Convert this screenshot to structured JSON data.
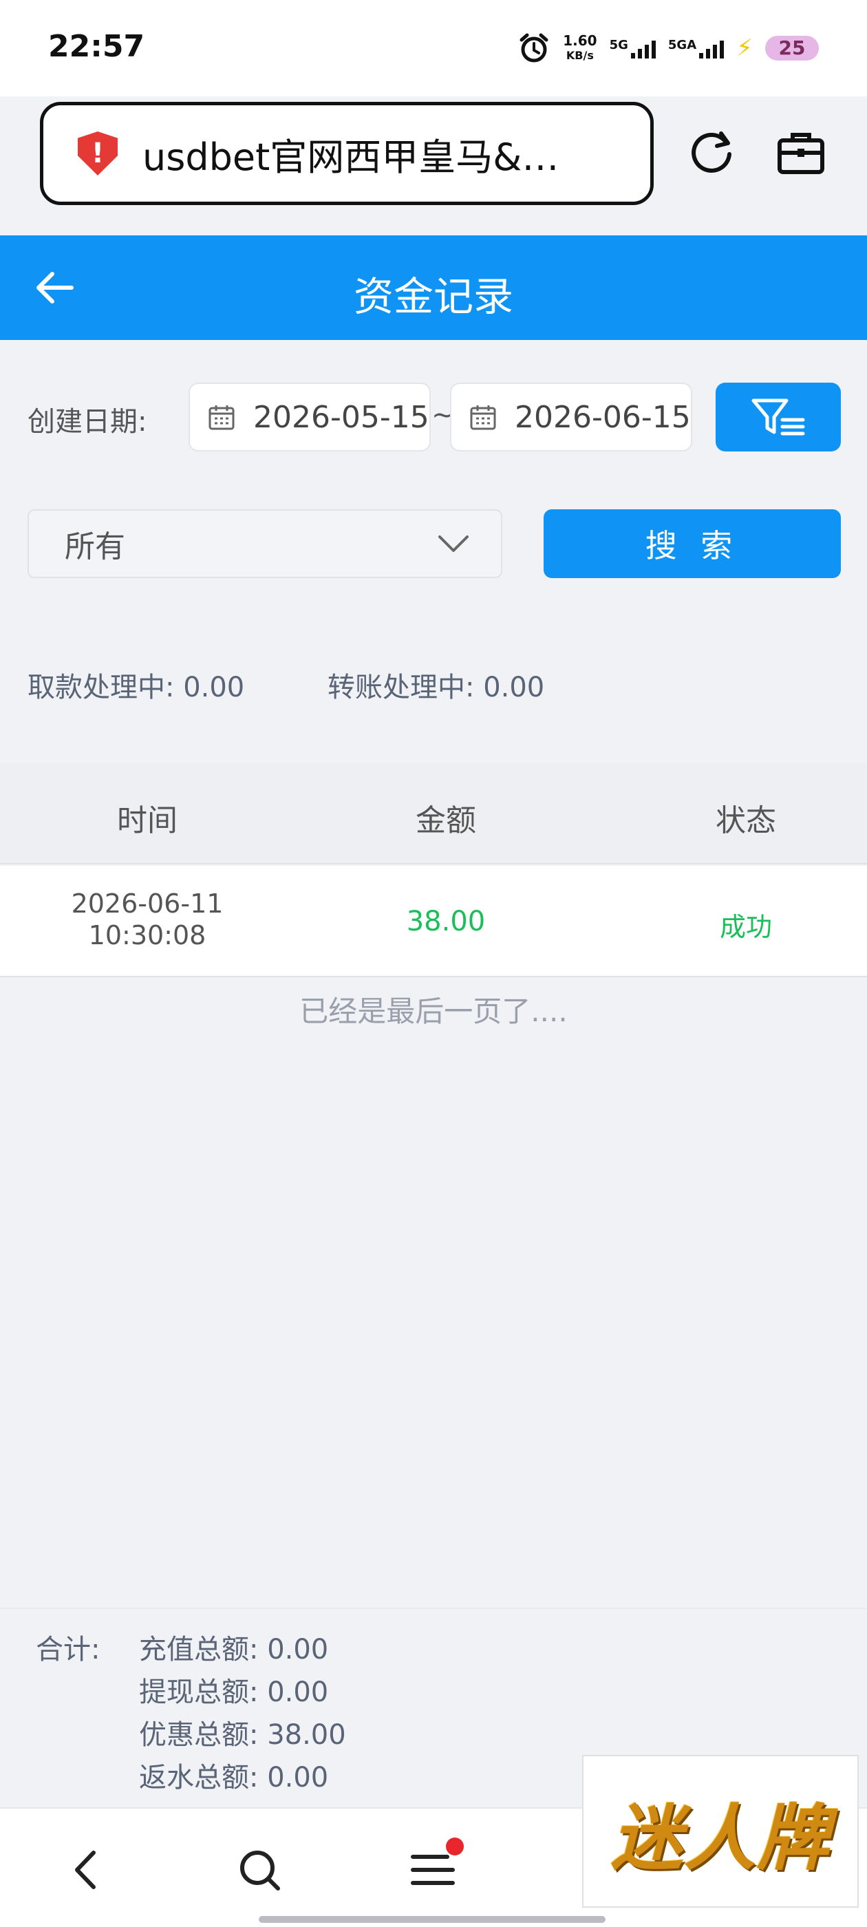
{
  "status_bar": {
    "time": "22:57",
    "speed_value": "1.60",
    "speed_unit": "KB/s",
    "net1": "5G",
    "net2": "5GA",
    "battery": "25"
  },
  "browser": {
    "url_text": "usdbet官网西甲皇马&…",
    "icons": [
      "shield-icon",
      "reload-icon",
      "briefcase-icon"
    ]
  },
  "header": {
    "title": "资金记录"
  },
  "filters": {
    "date_label": "创建日期:",
    "start_date": "2026-05-15",
    "separator": "~",
    "end_date": "2026-06-15",
    "type_selected": "所有",
    "search_label": "搜 索"
  },
  "processing": {
    "withdraw": "取款处理中: 0.00",
    "transfer": "转账处理中: 0.00"
  },
  "table": {
    "columns": [
      "时间",
      "金额",
      "状态"
    ],
    "rows": [
      {
        "date": "2026-06-11",
        "time": "10:30:08",
        "amount": "38.00",
        "status": "成功"
      }
    ],
    "end_note": "已经是最后一页了...."
  },
  "totals": {
    "label": "合计:",
    "lines": [
      "充值总额: 0.00",
      "提现总额: 0.00",
      "优惠总额: 38.00",
      "返水总额: 0.00"
    ]
  },
  "watermark": {
    "text": "迷人牌"
  },
  "colors": {
    "accent": "#0f94f5",
    "success": "#1bbf5a",
    "background": "#f1f2f6"
  }
}
